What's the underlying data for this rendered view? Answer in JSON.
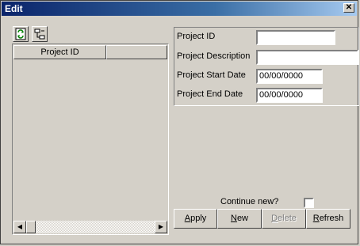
{
  "window": {
    "title": "Edit",
    "close_glyph": "✕"
  },
  "toolbar": [
    {
      "icon": "refresh-icon"
    },
    {
      "icon": "tree-icon"
    }
  ],
  "list": {
    "columns": [
      "Project ID",
      ""
    ]
  },
  "form": {
    "fields": [
      {
        "label": "Project ID",
        "value": ""
      },
      {
        "label": "Project Description",
        "value": ""
      },
      {
        "label": "Project Start Date",
        "value": "00/00/0000"
      },
      {
        "label": "Project End Date",
        "value": "00/00/0000"
      }
    ]
  },
  "continue_new": {
    "label": "Continue new?",
    "checked": false
  },
  "buttons": {
    "apply": {
      "mnemonic": "A",
      "rest": "pply"
    },
    "new": {
      "mnemonic": "N",
      "rest": "ew"
    },
    "delete": {
      "mnemonic": "D",
      "rest": "elete",
      "disabled": true
    },
    "refresh": {
      "mnemonic": "R",
      "rest": "efresh"
    }
  },
  "scrollbar": {
    "left_arrow": "◀",
    "right_arrow": "▶"
  }
}
